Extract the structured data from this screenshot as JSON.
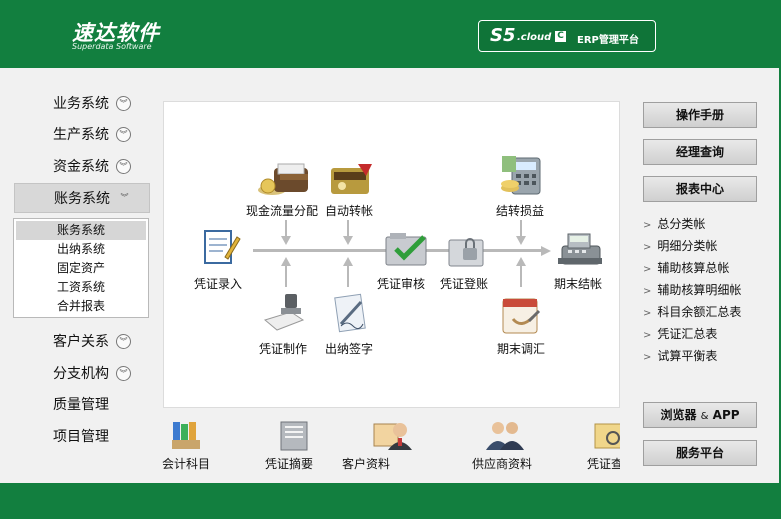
{
  "header": {
    "logo_cn": "速达软件",
    "logo_en": "Superdata Software",
    "badge_s5": "S5",
    "badge_cloud": ".cloud",
    "badge_c": "C",
    "badge_text": "ERP管理平台"
  },
  "nav": {
    "items": [
      {
        "label": "业务系统"
      },
      {
        "label": "生产系统"
      },
      {
        "label": "资金系统"
      },
      {
        "label": "账务系统"
      },
      {
        "label": "客户关系"
      },
      {
        "label": "分支机构"
      },
      {
        "label": "质量管理"
      },
      {
        "label": "项目管理"
      }
    ],
    "submenu": [
      "账务系统",
      "出纳系统",
      "固定资产",
      "工资系统",
      "合并报表"
    ]
  },
  "flow": {
    "cashflow": "现金流量分配",
    "autotransfer": "自动转帐",
    "carryover": "结转损益",
    "entry": "凭证录入",
    "review": "凭证审核",
    "posting": "凭证登账",
    "closing": "期末结帐",
    "make": "凭证制作",
    "cashier_sign": "出纳签字",
    "adjust": "期末调汇"
  },
  "quickbar": [
    "会计科目",
    "凭证摘要",
    "客户资料",
    "供应商资料",
    "凭证查"
  ],
  "right": {
    "manual": "操作手册",
    "manager_query": "经理查询",
    "report_center": "报表中心",
    "links": [
      "总分类帐",
      "明细分类帐",
      "辅助核算总帐",
      "辅助核算明细帐",
      "科目余额汇总表",
      "凭证汇总表",
      "试算平衡表"
    ],
    "browser_btn": "浏览器",
    "browser_amp": "&",
    "browser_app": "APP",
    "service_btn": "服务平台"
  }
}
